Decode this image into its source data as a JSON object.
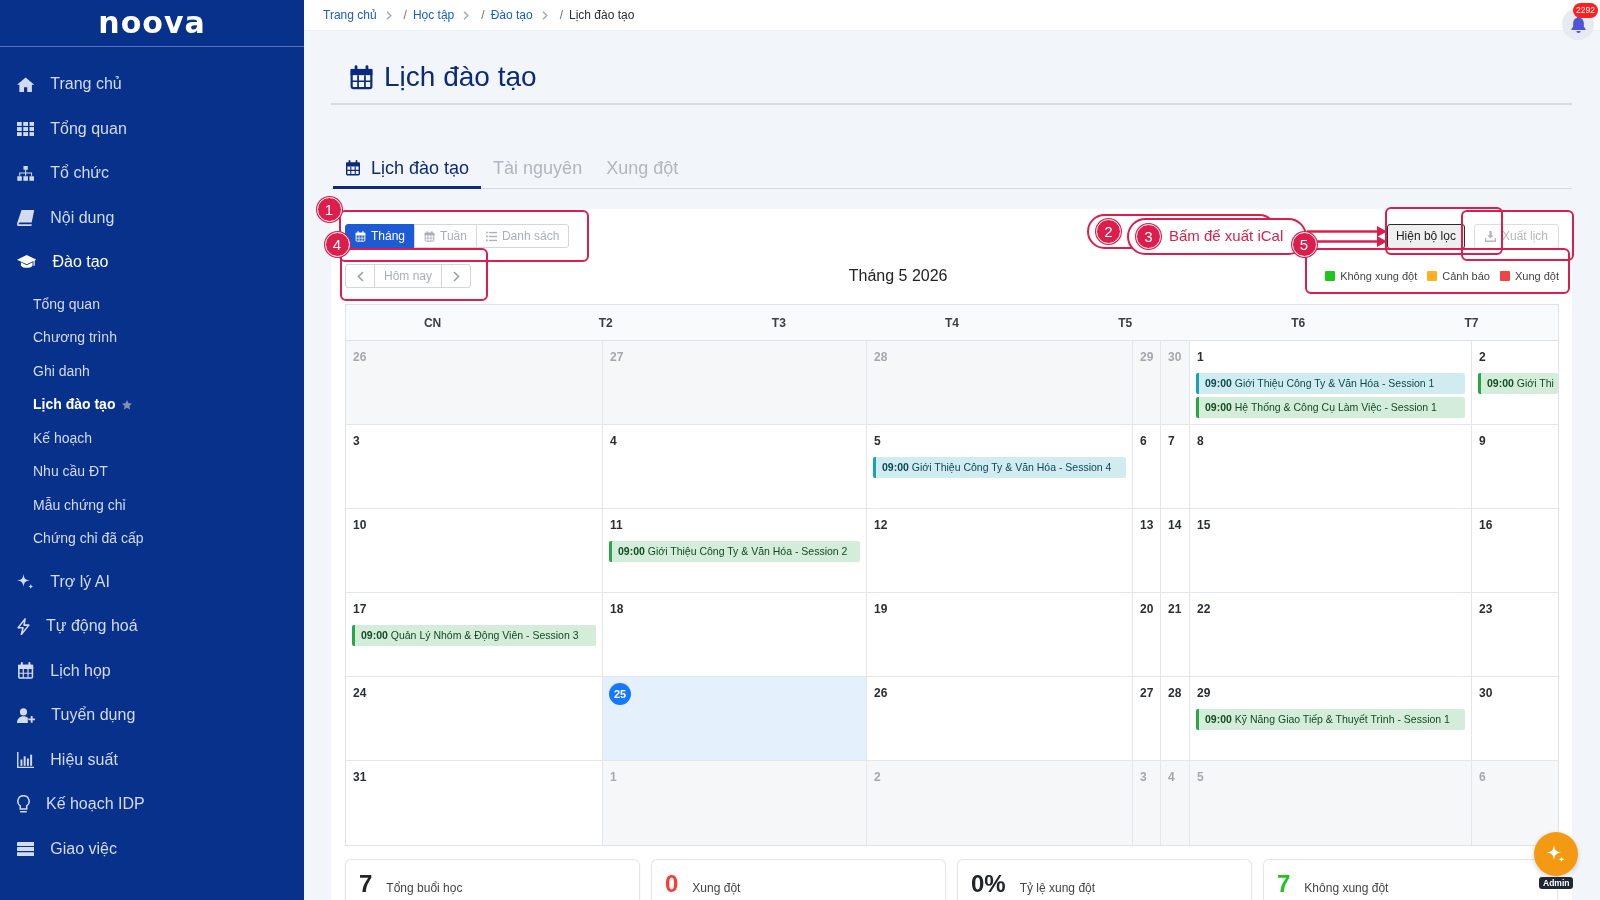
{
  "sidebar": {
    "logo": "noova",
    "items": [
      {
        "label": "Trang chủ",
        "selected": false
      },
      {
        "label": "Tổng quan",
        "selected": false
      },
      {
        "label": "Tổ chức",
        "selected": false
      },
      {
        "label": "Nội dung",
        "selected": false
      },
      {
        "label": "Đào tạo",
        "selected": true,
        "children": [
          {
            "label": "Tổng quan",
            "selected": false,
            "starred": false
          },
          {
            "label": "Chương trình",
            "selected": false,
            "starred": false
          },
          {
            "label": "Ghi danh",
            "selected": false,
            "starred": false
          },
          {
            "label": "Lịch đào tạo",
            "selected": true,
            "starred": true
          },
          {
            "label": "Kế hoạch",
            "selected": false,
            "starred": false
          },
          {
            "label": "Nhu cầu ĐT",
            "selected": false,
            "starred": false
          },
          {
            "label": "Mẫu chứng chỉ",
            "selected": false,
            "starred": false
          },
          {
            "label": "Chứng chỉ đã cấp",
            "selected": false,
            "starred": false
          }
        ]
      },
      {
        "label": "Trợ lý AI",
        "selected": false
      },
      {
        "label": "Tự động hoá",
        "selected": false
      },
      {
        "label": "Lịch họp",
        "selected": false
      },
      {
        "label": "Tuyển dụng",
        "selected": false
      },
      {
        "label": "Hiệu suất",
        "selected": false
      },
      {
        "label": "Kế hoạch IDP",
        "selected": false
      },
      {
        "label": "Giao việc",
        "selected": false
      }
    ]
  },
  "breadcrumb": [
    {
      "label": "Trang chủ",
      "current": false
    },
    {
      "prefix": "/",
      "label": "Học tập",
      "current": false
    },
    {
      "prefix": "/",
      "label": "Đào tạo",
      "current": false
    },
    {
      "prefix": "/",
      "label": "Lịch đào tạo",
      "current": true
    }
  ],
  "notifications": {
    "count": "2292"
  },
  "page_title": "Lịch đào tạo",
  "tabs": [
    {
      "label": "Lịch đào tạo",
      "selected": true
    },
    {
      "label": "Tài nguyên",
      "selected": false
    },
    {
      "label": "Xung đột",
      "selected": false
    }
  ],
  "toolbar": {
    "views": [
      {
        "label": "Tháng",
        "selected": true
      },
      {
        "label": "Tuần",
        "selected": false
      },
      {
        "label": "Danh sách",
        "selected": false
      }
    ],
    "today_button": "Hôm nay",
    "title": "Tháng 5 2026",
    "filter_button": {
      "label": "Hiện bộ lọc",
      "focused": true
    },
    "export_button": {
      "label": "Xuất lịch",
      "disabled": true
    },
    "legend": [
      {
        "label": "Không xung đột",
        "color": "#1ec71e"
      },
      {
        "label": "Cảnh báo",
        "color": "#ffb020"
      },
      {
        "label": "Xung đột",
        "color": "#f04444"
      }
    ]
  },
  "calendar": {
    "weekdays": [
      "CN",
      "T2",
      "T3",
      "T4",
      "T5",
      "T6",
      "T7"
    ],
    "weeks": [
      {
        "days": [
          {
            "day": "26",
            "outside": true,
            "today": false
          },
          {
            "day": "27",
            "outside": true,
            "today": false
          },
          {
            "day": "28",
            "outside": true,
            "today": false
          },
          {
            "day": "29",
            "outside": true,
            "today": false
          },
          {
            "day": "30",
            "outside": true,
            "today": false
          },
          {
            "day": "1",
            "outside": false,
            "today": false,
            "events": [
              {
                "time": "09:00",
                "title": "Giới Thiệu Công Ty & Văn Hóa - Session 1",
                "color": "#17a2b8"
              },
              {
                "time": "09:00",
                "title": "Hệ Thống & Công Cụ Làm Việc - Session 1",
                "color": "#28a745"
              }
            ]
          },
          {
            "day": "2",
            "outside": false,
            "today": false,
            "events": [
              {
                "time": "09:00",
                "title": "Giới Thi",
                "color": "#28a745"
              }
            ]
          }
        ]
      },
      {
        "days": [
          {
            "day": "3",
            "outside": false,
            "today": false
          },
          {
            "day": "4",
            "outside": false,
            "today": false
          },
          {
            "day": "5",
            "outside": false,
            "today": false,
            "events": [
              {
                "time": "09:00",
                "title": "Giới Thiệu Công Ty & Văn Hóa - Session 4",
                "color": "#17a2b8"
              }
            ]
          },
          {
            "day": "6",
            "outside": false,
            "today": false
          },
          {
            "day": "7",
            "outside": false,
            "today": false
          },
          {
            "day": "8",
            "outside": false,
            "today": false
          },
          {
            "day": "9",
            "outside": false,
            "today": false
          }
        ]
      },
      {
        "days": [
          {
            "day": "10",
            "outside": false,
            "today": false
          },
          {
            "day": "11",
            "outside": false,
            "today": false,
            "events": [
              {
                "time": "09:00",
                "title": "Giới Thiệu Công Ty & Văn Hóa - Session 2",
                "color": "#28a745"
              }
            ]
          },
          {
            "day": "12",
            "outside": false,
            "today": false
          },
          {
            "day": "13",
            "outside": false,
            "today": false
          },
          {
            "day": "14",
            "outside": false,
            "today": false
          },
          {
            "day": "15",
            "outside": false,
            "today": false
          },
          {
            "day": "16",
            "outside": false,
            "today": false
          }
        ]
      },
      {
        "days": [
          {
            "day": "17",
            "outside": false,
            "today": false,
            "events": [
              {
                "time": "09:00",
                "title": "Quản Lý Nhóm & Động Viên - Session 3",
                "color": "#28a745"
              }
            ]
          },
          {
            "day": "18",
            "outside": false,
            "today": false
          },
          {
            "day": "19",
            "outside": false,
            "today": false
          },
          {
            "day": "20",
            "outside": false,
            "today": false
          },
          {
            "day": "21",
            "outside": false,
            "today": false
          },
          {
            "day": "22",
            "outside": false,
            "today": false
          },
          {
            "day": "23",
            "outside": false,
            "today": false
          }
        ]
      },
      {
        "days": [
          {
            "day": "24",
            "outside": false,
            "today": false
          },
          {
            "day": "25",
            "outside": false,
            "today": true
          },
          {
            "day": "26",
            "outside": false,
            "today": false
          },
          {
            "day": "27",
            "outside": false,
            "today": false
          },
          {
            "day": "28",
            "outside": false,
            "today": false
          },
          {
            "day": "29",
            "outside": false,
            "today": false,
            "events": [
              {
                "time": "09:00",
                "title": "Kỹ Năng Giao Tiếp & Thuyết Trình - Session 1",
                "color": "#28a745"
              }
            ]
          },
          {
            "day": "30",
            "outside": false,
            "today": false
          }
        ]
      },
      {
        "days": [
          {
            "day": "31",
            "outside": false,
            "today": false
          },
          {
            "day": "1",
            "outside": true,
            "today": false
          },
          {
            "day": "2",
            "outside": true,
            "today": false
          },
          {
            "day": "3",
            "outside": true,
            "today": false
          },
          {
            "day": "4",
            "outside": true,
            "today": false
          },
          {
            "day": "5",
            "outside": true,
            "today": false
          },
          {
            "day": "6",
            "outside": true,
            "today": false
          }
        ]
      }
    ]
  },
  "stats": [
    {
      "value": "7",
      "label": "Tổng buổi học",
      "color": "#212529"
    },
    {
      "value": "0",
      "label": "Xung đột",
      "color": "#ff3b30"
    },
    {
      "value": "0%",
      "label": "Tỷ lệ xung đột",
      "color": "#212529"
    },
    {
      "value": "7",
      "label": "Không xung đột",
      "color": "#22c322"
    }
  ],
  "assistant": {
    "badge": "Admin"
  },
  "annotations": [
    {
      "kind": "box",
      "number": "1"
    },
    {
      "kind": "box",
      "number": "4"
    },
    {
      "kind": "callout",
      "number": "2"
    },
    {
      "kind": "callout",
      "number": "3",
      "text": "Bấm để xuất iCal"
    },
    {
      "kind": "box",
      "number": "5"
    }
  ]
}
